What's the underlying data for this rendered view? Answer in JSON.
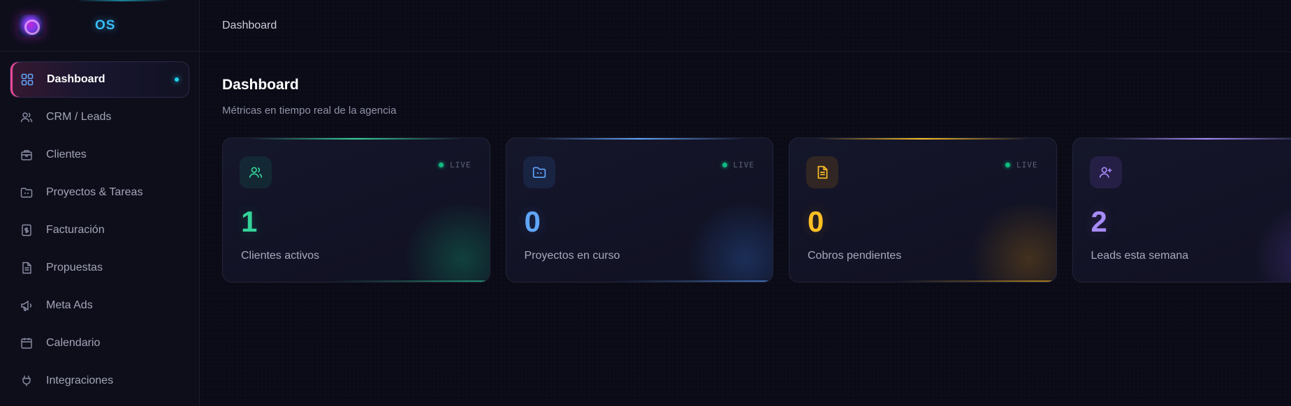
{
  "sidebar": {
    "brand": "OS",
    "items": [
      {
        "label": "Dashboard",
        "icon": "grid-icon",
        "active": true
      },
      {
        "label": "CRM / Leads",
        "icon": "users-icon"
      },
      {
        "label": "Clientes",
        "icon": "building-icon"
      },
      {
        "label": "Proyectos & Tareas",
        "icon": "folder-icon"
      },
      {
        "label": "Facturación",
        "icon": "invoice-icon"
      },
      {
        "label": "Propuestas",
        "icon": "document-icon"
      },
      {
        "label": "Meta Ads",
        "icon": "megaphone-icon"
      },
      {
        "label": "Calendario",
        "icon": "calendar-icon"
      },
      {
        "label": "Integraciones",
        "icon": "plug-icon"
      }
    ]
  },
  "topbar": {
    "breadcrumb": "Dashboard"
  },
  "main": {
    "title": "Dashboard",
    "subtitle": "Métricas en tiempo real de la agencia",
    "cards": [
      {
        "value": "1",
        "label": "Clientes activos",
        "badge": "LIVE",
        "icon": "users-icon",
        "accent": "#34d399"
      },
      {
        "value": "0",
        "label": "Proyectos en curso",
        "badge": "LIVE",
        "icon": "folder-icon",
        "accent": "#60a5fa"
      },
      {
        "value": "0",
        "label": "Cobros pendientes",
        "badge": "LIVE",
        "icon": "invoice-icon",
        "accent": "#fbbf24"
      },
      {
        "value": "2",
        "label": "Leads esta semana",
        "badge": "",
        "icon": "user-plus-icon",
        "accent": "#a78bfa"
      }
    ]
  },
  "colors": {
    "background": "#0b0b17",
    "sidebar": "#0e0e1b",
    "active_indicator": "#ec4899",
    "live_dot": "#10b981",
    "brand": "#38bdf8"
  }
}
